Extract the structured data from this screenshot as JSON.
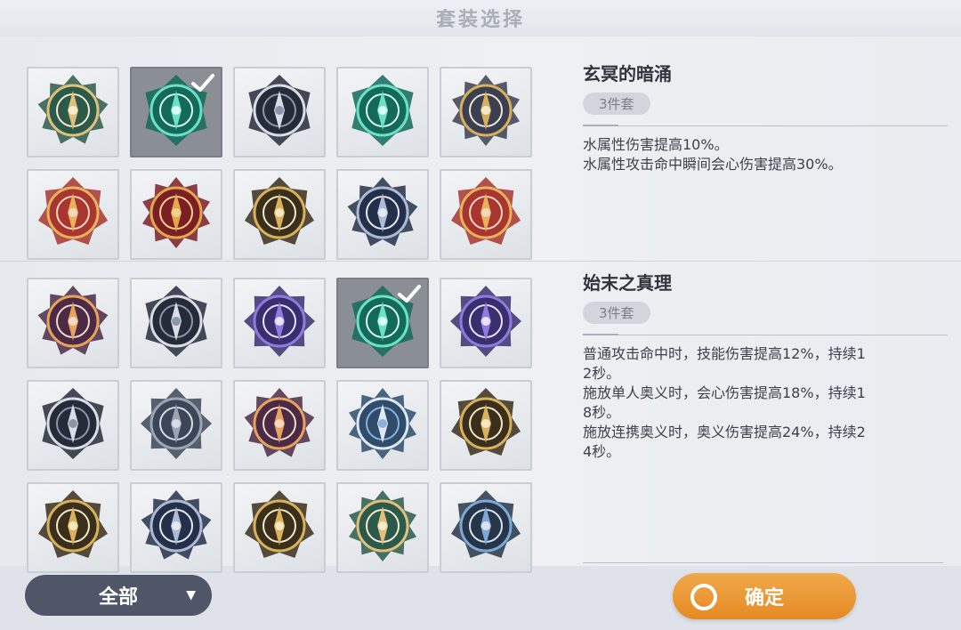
{
  "window": {
    "title": "套装选择"
  },
  "colors": {
    "accent": "#e9922f",
    "filter_bg": "#4f5667",
    "selected_slot": "#8a8e95"
  },
  "set_1": {
    "name": "玄冥的暗涌",
    "piece_count": "3件套",
    "effects": [
      "水属性伤害提高10%。",
      "水属性攻击命中瞬间会心伤害提高30%。"
    ],
    "grid": {
      "rows": 2,
      "cols": 5,
      "selected_index": 1,
      "icons": [
        "spiral-emblem-icon",
        "serpent-emblem-icon",
        "horned-mask-emblem-icon",
        "tiger-emblem-icon",
        "crescent-emblem-icon",
        "red-orbit-emblem-icon",
        "violet-arch-emblem-icon",
        "blue-compass-emblem-icon",
        "crimson-crest-emblem-icon",
        "lotus-emblem-icon"
      ]
    }
  },
  "set_2": {
    "name": "始末之真理",
    "piece_count": "3件套",
    "effects": [
      "普通攻击命中时，技能伤害提高12%，持续1\n2秒。",
      "施放单人奥义时，会心伤害提高18%，持续1\n8秒。",
      "施放连携奥义时，奥义伤害提高24%，持续2\n4秒。"
    ],
    "grid": {
      "rows": 3,
      "cols": 5,
      "selected_index": 3,
      "icons": [
        "violet-arch-emblem-icon",
        "blue-compass-emblem-icon",
        "crimson-crest-emblem-icon",
        "lotus-emblem-icon",
        "golden-mask-emblem-icon",
        "mountain-emblem-icon",
        "wolf-emblem-icon",
        "star-emblem-icon",
        "snake-triangle-emblem-icon",
        "dark-crest-emblem-icon",
        "teal-wave-emblem-icon",
        "pink-swirl-emblem-icon",
        "pharaoh-emblem-icon",
        "crossed-blades-emblem-icon",
        "jade-cross-emblem-icon"
      ]
    }
  },
  "footer": {
    "filter_label": "全部",
    "confirm_label": "确定"
  }
}
